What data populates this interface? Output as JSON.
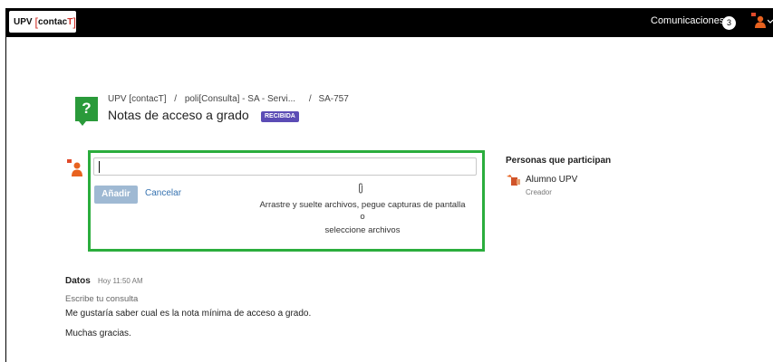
{
  "header": {
    "logo": {
      "prefix": "UPV",
      "open_bracket": "[",
      "name": "contac",
      "t": "T",
      "close_bracket": "]"
    },
    "communications_label": "Comunicaciones",
    "communications_count": "3"
  },
  "request": {
    "breadcrumb": [
      "UPV [contacT]",
      "poli[Consulta] - SA - Servi...",
      "SA-757"
    ],
    "breadcrumb_sep": "/",
    "title": "Notas de acceso a grado",
    "status": "RECIBIDA"
  },
  "comment": {
    "add_label": "Añadir",
    "cancel_label": "Cancelar",
    "drop_line1": "Arrastre y suelte archivos, pegue capturas de pantalla",
    "drop_line2": "o",
    "drop_line3": "seleccione archivos"
  },
  "participants": {
    "title": "Personas que participan",
    "items": [
      {
        "name": "Alumno UPV",
        "role": "Creador"
      }
    ]
  },
  "details": {
    "label": "Datos",
    "time": "Hoy 11:50 AM",
    "question_label": "Escribe tu consulta",
    "question_line1": "Me gustaría saber cual es la nota mínima de acceso a grado.",
    "question_line2": "Muchas gracias."
  },
  "colors": {
    "topbar": "#000000",
    "status": "#5b4cb5",
    "highlight": "#2bad3d",
    "link": "#3572b0",
    "help_icon": "#2a9a3a"
  }
}
